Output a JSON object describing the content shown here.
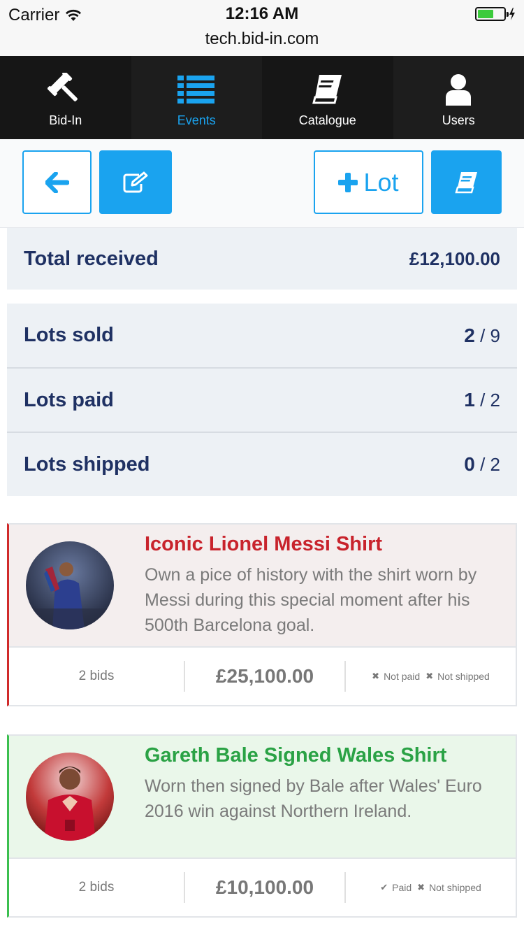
{
  "status_bar": {
    "carrier": "Carrier",
    "time": "12:16 AM",
    "url": "tech.bid-in.com"
  },
  "nav": [
    {
      "label": "Bid-In",
      "icon": "gavel-icon"
    },
    {
      "label": "Events",
      "icon": "list-icon"
    },
    {
      "label": "Catalogue",
      "icon": "book-icon"
    },
    {
      "label": "Users",
      "icon": "user-icon"
    }
  ],
  "toolbar": {
    "lot_label": "Lot"
  },
  "stats": {
    "total_received": {
      "label": "Total received",
      "value": "£12,100.00"
    },
    "lots_sold": {
      "label": "Lots sold",
      "count": "2",
      "total": "/ 9"
    },
    "lots_paid": {
      "label": "Lots paid",
      "count": "1",
      "total": "/ 2"
    },
    "lots_shipped": {
      "label": "Lots shipped",
      "count": "0",
      "total": "/ 2"
    }
  },
  "lots": [
    {
      "title": "Iconic Lionel Messi Shirt",
      "description": "Own a pice of history with the shirt worn by Messi during this special moment after his 500th Barcelona goal.",
      "bids": "2 bids",
      "amount": "£25,100.00",
      "payment_status": "Not paid",
      "shipping_status": "Not shipped"
    },
    {
      "title": "Gareth Bale Signed Wales Shirt",
      "description": "Worn then signed by Bale after Wales' Euro 2016 win against Northern Ireland.",
      "bids": "2 bids",
      "amount": "£10,100.00",
      "payment_status": "Paid",
      "shipping_status": "Not shipped"
    }
  ],
  "colors": {
    "accent": "#1aa3ef",
    "unpaid": "#c8232c",
    "paid": "#2aa245",
    "stat_bg": "#edf1f5"
  }
}
